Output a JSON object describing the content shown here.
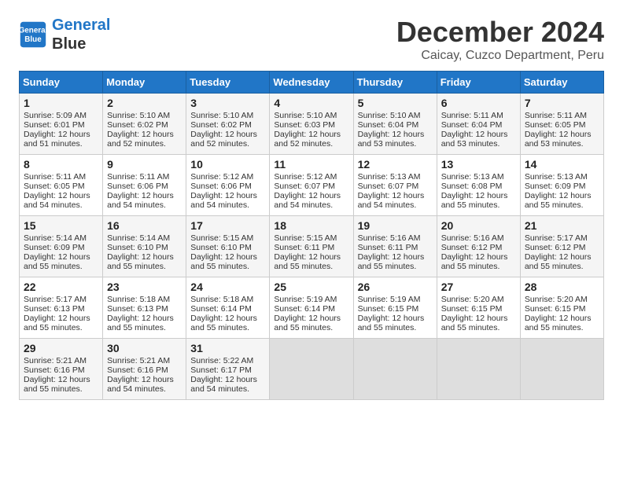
{
  "header": {
    "logo_line1": "General",
    "logo_line2": "Blue",
    "month": "December 2024",
    "location": "Caicay, Cuzco Department, Peru"
  },
  "days_of_week": [
    "Sunday",
    "Monday",
    "Tuesday",
    "Wednesday",
    "Thursday",
    "Friday",
    "Saturday"
  ],
  "weeks": [
    [
      {
        "day": "1",
        "info": "Sunrise: 5:09 AM\nSunset: 6:01 PM\nDaylight: 12 hours\nand 51 minutes."
      },
      {
        "day": "2",
        "info": "Sunrise: 5:10 AM\nSunset: 6:02 PM\nDaylight: 12 hours\nand 52 minutes."
      },
      {
        "day": "3",
        "info": "Sunrise: 5:10 AM\nSunset: 6:02 PM\nDaylight: 12 hours\nand 52 minutes."
      },
      {
        "day": "4",
        "info": "Sunrise: 5:10 AM\nSunset: 6:03 PM\nDaylight: 12 hours\nand 52 minutes."
      },
      {
        "day": "5",
        "info": "Sunrise: 5:10 AM\nSunset: 6:04 PM\nDaylight: 12 hours\nand 53 minutes."
      },
      {
        "day": "6",
        "info": "Sunrise: 5:11 AM\nSunset: 6:04 PM\nDaylight: 12 hours\nand 53 minutes."
      },
      {
        "day": "7",
        "info": "Sunrise: 5:11 AM\nSunset: 6:05 PM\nDaylight: 12 hours\nand 53 minutes."
      }
    ],
    [
      {
        "day": "8",
        "info": "Sunrise: 5:11 AM\nSunset: 6:05 PM\nDaylight: 12 hours\nand 54 minutes."
      },
      {
        "day": "9",
        "info": "Sunrise: 5:11 AM\nSunset: 6:06 PM\nDaylight: 12 hours\nand 54 minutes."
      },
      {
        "day": "10",
        "info": "Sunrise: 5:12 AM\nSunset: 6:06 PM\nDaylight: 12 hours\nand 54 minutes."
      },
      {
        "day": "11",
        "info": "Sunrise: 5:12 AM\nSunset: 6:07 PM\nDaylight: 12 hours\nand 54 minutes."
      },
      {
        "day": "12",
        "info": "Sunrise: 5:13 AM\nSunset: 6:07 PM\nDaylight: 12 hours\nand 54 minutes."
      },
      {
        "day": "13",
        "info": "Sunrise: 5:13 AM\nSunset: 6:08 PM\nDaylight: 12 hours\nand 55 minutes."
      },
      {
        "day": "14",
        "info": "Sunrise: 5:13 AM\nSunset: 6:09 PM\nDaylight: 12 hours\nand 55 minutes."
      }
    ],
    [
      {
        "day": "15",
        "info": "Sunrise: 5:14 AM\nSunset: 6:09 PM\nDaylight: 12 hours\nand 55 minutes."
      },
      {
        "day": "16",
        "info": "Sunrise: 5:14 AM\nSunset: 6:10 PM\nDaylight: 12 hours\nand 55 minutes."
      },
      {
        "day": "17",
        "info": "Sunrise: 5:15 AM\nSunset: 6:10 PM\nDaylight: 12 hours\nand 55 minutes."
      },
      {
        "day": "18",
        "info": "Sunrise: 5:15 AM\nSunset: 6:11 PM\nDaylight: 12 hours\nand 55 minutes."
      },
      {
        "day": "19",
        "info": "Sunrise: 5:16 AM\nSunset: 6:11 PM\nDaylight: 12 hours\nand 55 minutes."
      },
      {
        "day": "20",
        "info": "Sunrise: 5:16 AM\nSunset: 6:12 PM\nDaylight: 12 hours\nand 55 minutes."
      },
      {
        "day": "21",
        "info": "Sunrise: 5:17 AM\nSunset: 6:12 PM\nDaylight: 12 hours\nand 55 minutes."
      }
    ],
    [
      {
        "day": "22",
        "info": "Sunrise: 5:17 AM\nSunset: 6:13 PM\nDaylight: 12 hours\nand 55 minutes."
      },
      {
        "day": "23",
        "info": "Sunrise: 5:18 AM\nSunset: 6:13 PM\nDaylight: 12 hours\nand 55 minutes."
      },
      {
        "day": "24",
        "info": "Sunrise: 5:18 AM\nSunset: 6:14 PM\nDaylight: 12 hours\nand 55 minutes."
      },
      {
        "day": "25",
        "info": "Sunrise: 5:19 AM\nSunset: 6:14 PM\nDaylight: 12 hours\nand 55 minutes."
      },
      {
        "day": "26",
        "info": "Sunrise: 5:19 AM\nSunset: 6:15 PM\nDaylight: 12 hours\nand 55 minutes."
      },
      {
        "day": "27",
        "info": "Sunrise: 5:20 AM\nSunset: 6:15 PM\nDaylight: 12 hours\nand 55 minutes."
      },
      {
        "day": "28",
        "info": "Sunrise: 5:20 AM\nSunset: 6:15 PM\nDaylight: 12 hours\nand 55 minutes."
      }
    ],
    [
      {
        "day": "29",
        "info": "Sunrise: 5:21 AM\nSunset: 6:16 PM\nDaylight: 12 hours\nand 55 minutes."
      },
      {
        "day": "30",
        "info": "Sunrise: 5:21 AM\nSunset: 6:16 PM\nDaylight: 12 hours\nand 54 minutes."
      },
      {
        "day": "31",
        "info": "Sunrise: 5:22 AM\nSunset: 6:17 PM\nDaylight: 12 hours\nand 54 minutes."
      },
      {
        "day": "",
        "info": ""
      },
      {
        "day": "",
        "info": ""
      },
      {
        "day": "",
        "info": ""
      },
      {
        "day": "",
        "info": ""
      }
    ]
  ]
}
